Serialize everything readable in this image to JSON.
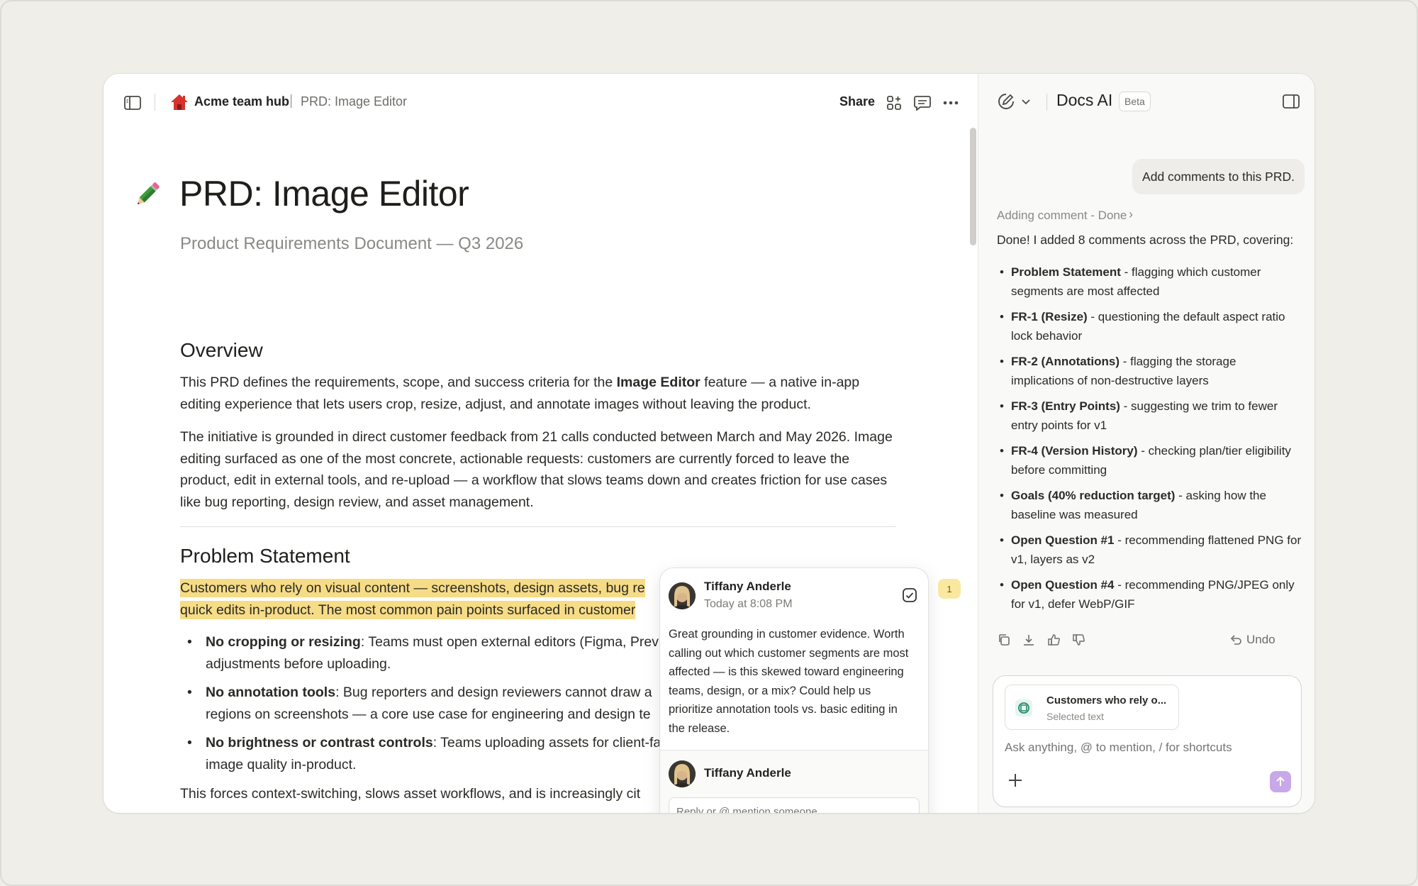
{
  "header": {
    "workspace": "Acme team hub",
    "separator": "|",
    "page": "PRD: Image Editor",
    "share_label": "Share"
  },
  "doc": {
    "title": "PRD: Image Editor",
    "subtitle": "Product Requirements Document — Q3 2026",
    "overview_heading": "Overview",
    "overview_p1_a": "This PRD defines the requirements, scope, and success criteria for the ",
    "overview_p1_b": "Image Editor",
    "overview_p1_c": " feature — a native in-app editing experience that lets users crop, resize, adjust, and annotate images without leaving the product.",
    "overview_p2": "The initiative is grounded in direct customer feedback from 21 calls conducted between March and May 2026. Image editing surfaced as one of the most concrete, actionable requests: customers are currently forced to leave the product, edit in external tools, and re-upload — a workflow that slows teams down and creates friction for use cases like bug reporting, design review, and asset management.",
    "problem_heading": "Problem Statement",
    "problem_line1": "Customers who rely on visual content — screenshots, design assets, bug re",
    "problem_line2": "quick edits in-product. The most common pain points surfaced in customer",
    "bullets": [
      {
        "bold": "No cropping or resizing",
        "rest": ": Teams must open external editors (Figma, Prev",
        "line2": "adjustments before uploading."
      },
      {
        "bold": "No annotation tools",
        "rest": ": Bug reporters and design reviewers cannot draw a",
        "line2": "regions on screenshots — a core use case for engineering and design te"
      },
      {
        "bold": "No brightness or contrast controls",
        "rest": ": Teams uploading assets for client-fa",
        "line2": "image quality in-product."
      }
    ],
    "last_para": "This forces context-switching, slows asset workflows, and is increasingly cit"
  },
  "comment": {
    "author": "Tiffany Anderle",
    "time": "Today at 8:08 PM",
    "body": "Great grounding in customer evidence. Worth calling out which customer segments are most affected — is this skewed toward engineering teams, design, or a mix? Could help us prioritize annotation tools vs. basic editing in the release.",
    "reply_author": "Tiffany Anderle",
    "reply_placeholder": "Reply or @ mention someone",
    "count": "1"
  },
  "ai": {
    "title": "Docs AI",
    "badge": "Beta",
    "user_message": "Add comments to this PRD.",
    "status": "Adding comment - Done",
    "intro": "Done! I added 8 comments across the PRD, covering:",
    "items": [
      {
        "bold": "Problem Statement",
        "rest": " - flagging which customer segments are most affected"
      },
      {
        "bold": "FR-1 (Resize)",
        "rest": " - questioning the default aspect ratio lock behavior"
      },
      {
        "bold": "FR-2 (Annotations)",
        "rest": " - flagging the storage implications of non-destructive layers"
      },
      {
        "bold": "FR-3 (Entry Points)",
        "rest": " - suggesting we trim to fewer entry points for v1"
      },
      {
        "bold": "FR-4 (Version History)",
        "rest": " - checking plan/tier eligibility before committing"
      },
      {
        "bold": "Goals (40% reduction target)",
        "rest": " - asking how the baseline was measured"
      },
      {
        "bold": "Open Question #1",
        "rest": " - recommending flattened PNG for v1, layers as v2"
      },
      {
        "bold": "Open Question #4",
        "rest": " - recommending PNG/JPEG only for v1, defer WebP/GIF"
      }
    ],
    "undo_label": "Undo",
    "chip_title": "Customers who rely o...",
    "chip_sub": "Selected text",
    "input_placeholder": "Ask anything, @ to mention, / for shortcuts"
  },
  "colors": {
    "highlight": "#f6dc86",
    "send_button": "#c8a8e8",
    "background": "#efeee9"
  }
}
